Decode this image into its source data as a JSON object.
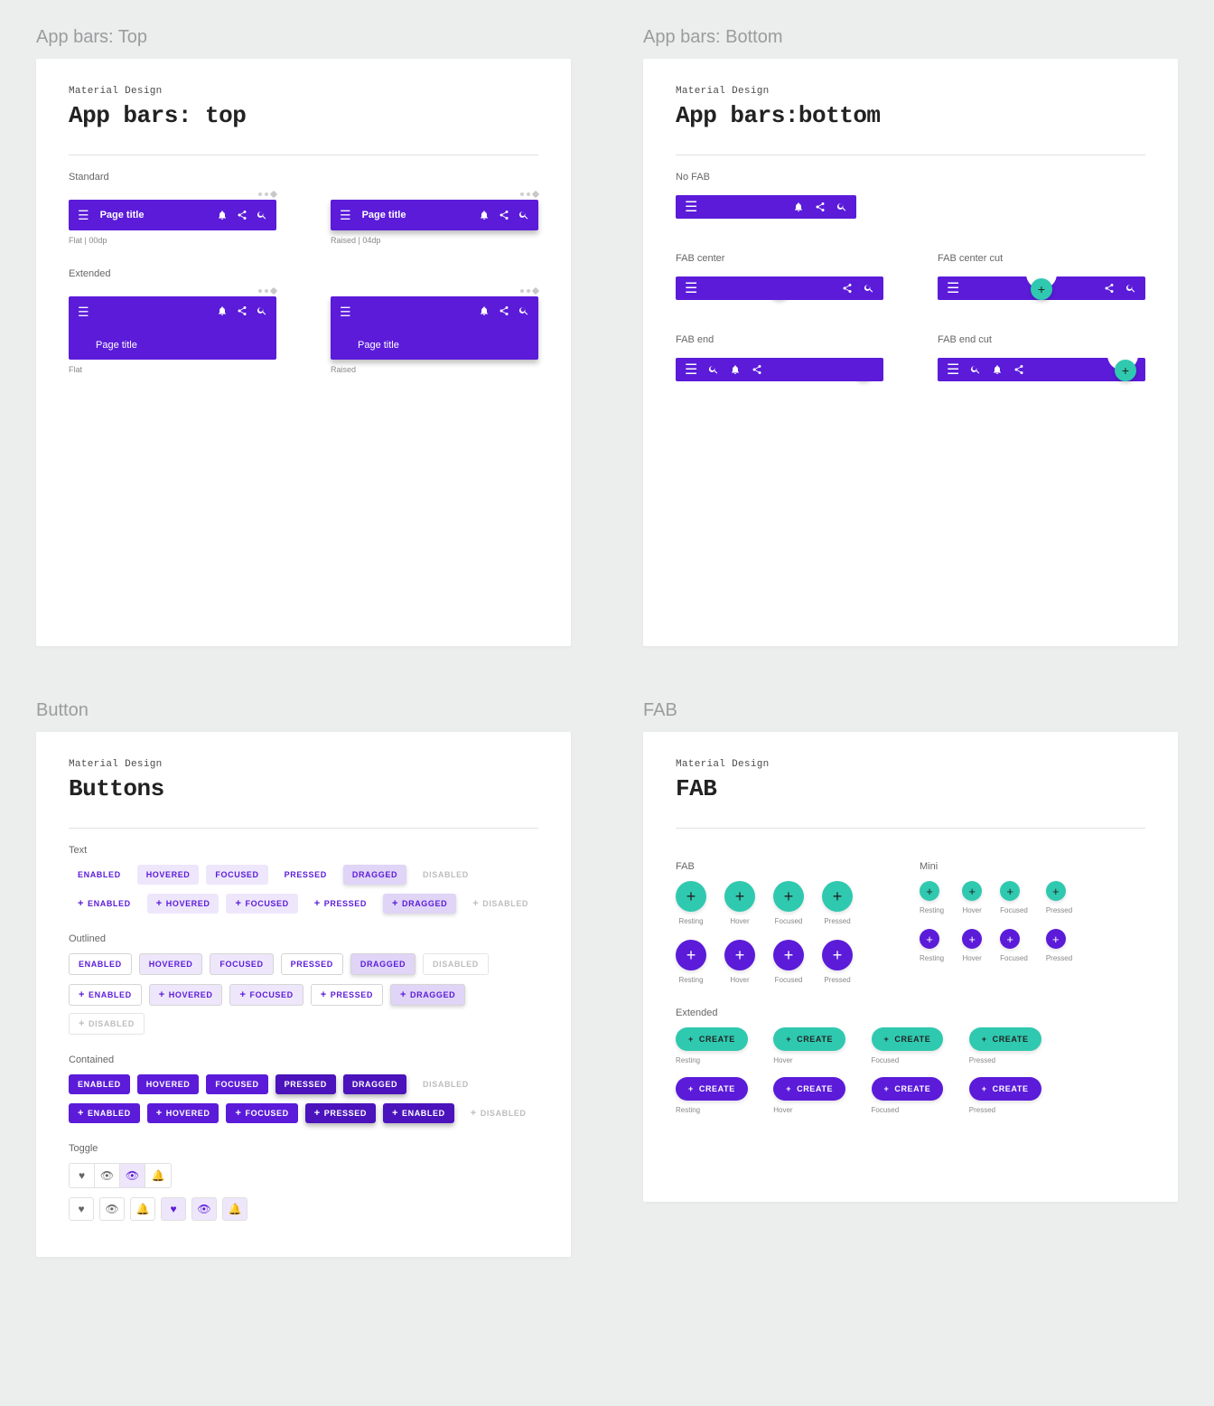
{
  "sections": {
    "top": {
      "label": "App bars: Top"
    },
    "bottom": {
      "label": "App bars: Bottom"
    },
    "button": {
      "label": "Button"
    },
    "fab": {
      "label": "FAB"
    }
  },
  "common": {
    "eyebrow": "Material Design"
  },
  "top_card": {
    "title": "App bars: top",
    "standard_label": "Standard",
    "extended_label": "Extended",
    "page_title": "Page title",
    "cap_flat_std": "Flat | 00dp",
    "cap_raised_std": "Raised | 04dp",
    "cap_flat": "Flat",
    "cap_raised": "Raised"
  },
  "bottom_card": {
    "title": "App bars:bottom",
    "nofab": "No FAB",
    "fab_center": "FAB center",
    "fab_center_cut": "FAB center cut",
    "fab_end": "FAB end",
    "fab_end_cut": "FAB end cut"
  },
  "buttons_card": {
    "title": "Buttons",
    "text_label": "Text",
    "outlined_label": "Outlined",
    "contained_label": "Contained",
    "toggle_label": "Toggle",
    "states": {
      "enabled": "ENABLED",
      "hovered": "HOVERED",
      "focused": "FOCUSED",
      "pressed": "PRESSED",
      "dragged": "DRAGGED",
      "disabled": "DISABLED"
    }
  },
  "fab_card": {
    "title": "FAB",
    "fab_label": "FAB",
    "mini_label": "Mini",
    "extended_label": "Extended",
    "create": "CREATE",
    "caps": {
      "resting": "Resting",
      "hover": "Hover",
      "focused": "Focused",
      "pressed": "Pressed"
    }
  }
}
